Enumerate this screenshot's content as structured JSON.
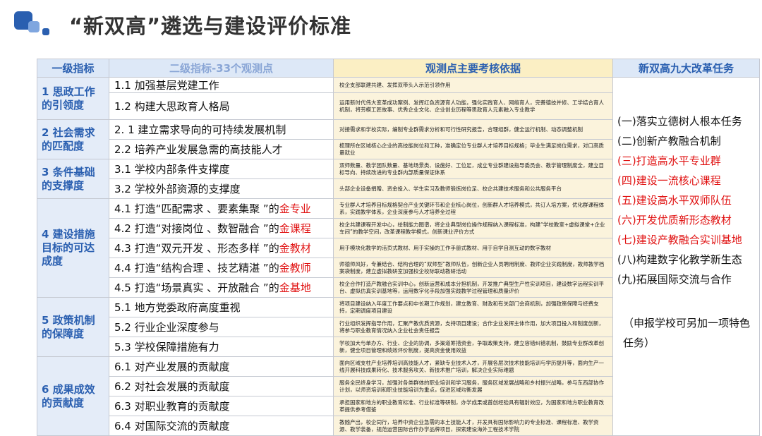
{
  "title": "“新双高”遴选与建设评价标准",
  "header": {
    "col1": "一级指标",
    "col2": "二级指标-33个观测点",
    "col3": "观测点主要考核依据",
    "col4": "新双高九大改革任务"
  },
  "groups": [
    {
      "label": "1 思政工作的引领度"
    },
    {
      "label": "2 社会需求的匹配度"
    },
    {
      "label": "3 条件基础的支撑度"
    },
    {
      "label": "4 建设措施目标的可达成度"
    },
    {
      "label": "5 政策机制的保障度"
    },
    {
      "label": "6 成果成效的贡献度"
    }
  ],
  "rows": [
    {
      "l2": "1.1 加强基层党建工作",
      "basis": "校企支部联建共建、发挥双带头人示范引领作用"
    },
    {
      "l2": "1.2 构建大思政育人格局",
      "basis": "运用新时代伟大变革成功案例、发挥红色资源育人功能，强化实践育人、网络育人，完善德技并修、工学结合育人机制，将劳模工匠故事、优秀企业文化、企业创业历程等思政育人元素融入专业教学"
    },
    {
      "l2": "2. 1 建立需求导向的可持续发展机制",
      "basis": "对接需求和学校实际，编制专业群需求分析和可行性研究报告，合理组群，健全运行机制、动态调整机制"
    },
    {
      "l2": "2.2 培养产业发展急需的高技能人才",
      "basis": "梳理所在区域核心企业的高技能岗位和工种，准确定位专业群人才培养目标规格；毕业生满足岗位需求，对口高质量就业"
    },
    {
      "l2": "3.1 学校内部条件支撑度",
      "basis": "双师数量、教学团队数量、基地场景类、设施好、工位足，成立专业群建设指导委员会、教学管理制度全，建立目标导向、持续改进的专业群内部质量保证体系"
    },
    {
      "l2": "3.2 学校外部资源的支撑度",
      "basis": "头部企业设备捐赠、资金投入、学生实习及教师锻炼岗位足、校企共建技术服务和公共服务平台"
    },
    {
      "l2_pre": "4.1 打造“匹配需求 、要素集聚 ”的",
      "l2_red": "金专业",
      "basis": "专业群人才培养目标规格契合产业关键环节和企业核心岗位，创新群人才培养模式，共订人培方案，优化群课程体系，实践教学体系，企业深度参与人才培养全过程"
    },
    {
      "l2_pre": "4.2 打造“对接岗位 、数智融合 ”的",
      "l2_red": "金课程",
      "basis": "校企共建课程开发中心，绘制能力图谱，将企业典型岗位操作规程纳入课程标准，构建“学校教室+虚拟课堂+企业车间”的教学空间，改革课程教学模式，创新课业评价方式"
    },
    {
      "l2_pre": "4.3 打造“双元开发 、形态多样 ”的",
      "l2_red": "金教材",
      "basis": "用于模块化教学的活页式教材、用于实操的工作手册式教材、用于自学自测互动的数字教材"
    },
    {
      "l2_pre": "4.4 打造“结构合理 、技艺精湛 ”的",
      "l2_red": "金教师",
      "basis": "师德师风好，专兼结合、结构合理的“双师型”教师队伍，创新企业人员聘用制度、教师企业实践制度，教师教学档案袋制度，建立虚拟教研室加强校企校际联动教研活动"
    },
    {
      "l2_pre": "4.5 打造“场景真实 、开放融合 ”的",
      "l2_red": "金基地",
      "basis": "校企合作打造产教融合实训中心，创新运营和成本分担机制，开发推广典型生产性实训项目，建设数字远程实训平台、虚拟仿真实训基地等，运用数字化手段加强实践教学过程管理和质量评价"
    },
    {
      "l2": "5.1 地方党委政府高度重视",
      "basis": "将项目建设纳入年度工作要点和中长期工作规划，建立教育、财政和有关部门会商机制，加强政策保障与经费支持，定期调度项目建设"
    },
    {
      "l2": "5.2 行业企业深度参与",
      "basis": "行业组织发挥指导作用，汇聚产教优质资源，支持项目建设；合作企业发挥主体作用，加大项目投入和制度创新，将参与职业教育情况纳入企业社会责任报告"
    },
    {
      "l2": "5.3 学校保障措施有力",
      "basis": "学校加大与单办方、行业、企业的协调，多渠道筹措资金，争取政策支持，建立容错纠错机制，鼓励专业群改革创新，健全项目管理和绩效评价制度，提高资金使用效益"
    },
    {
      "l2": "6.1 对产业发展的贡献度",
      "basis": "面向区域支柱产业培养培训高技能人才，紧缺专业技术人才，开展各层次技术技能培训与学历提升等，面向生产一线开展科技成果转化、技术服务攻关、新技术推广培训，解决企业实际难题"
    },
    {
      "l2": "6.2 对社会发展的贡献度",
      "basis": "服务全民终身学习，加强对各类群体的职业培训和学习服务，服务区域发展战略和乡村振兴战略，参与东西部协作计划，以师资培训和职业技能培训为重点，促进区域均衡发展"
    },
    {
      "l2": "6.3 对职业教育的贡献度",
      "basis": "承担国家和地方的职业教育标准、行业标准等研制，办学成果或首创经验具有辐射效应，为国家和地方职业教育改革提供参考借鉴"
    },
    {
      "l2": "6.4 对国际交流的贡献度",
      "basis": "教随产出，校企同行，培养中资企业急需的本土技能人才，开发具有国际影响力的专业标准、课程标准、教学资源、教学装备，规范运营国际合作办学品牌项目，探索建设海外工程技术学院"
    }
  ],
  "tasks": [
    {
      "text": "(一)落实立德树人根本任务",
      "color": "#111111"
    },
    {
      "text": "(二)创新产教融合机制",
      "color": "#111111"
    },
    {
      "text": "(三)打造高水平专业群",
      "color": "#e01010"
    },
    {
      "text": "(四)建设一流核心课程",
      "color": "#e01010"
    },
    {
      "text": "(五)建设高水平双师队伍",
      "color": "#e01010"
    },
    {
      "text": "(六)开发优质新形态教材",
      "color": "#e01010"
    },
    {
      "text": "(七)建设产教融合实训基地",
      "color": "#e01010"
    },
    {
      "text": "(八)构建数字化教学新生态",
      "color": "#111111"
    },
    {
      "text": "(九)拓展国际交流与合作",
      "color": "#111111"
    }
  ],
  "note": "（申报学校可另加一项特色任务）",
  "colors": {
    "accent_blue": "#2a5fb0",
    "header_bg": "#dde8f7",
    "basis_bg": "#fbf3dc",
    "red": "#e01010"
  }
}
